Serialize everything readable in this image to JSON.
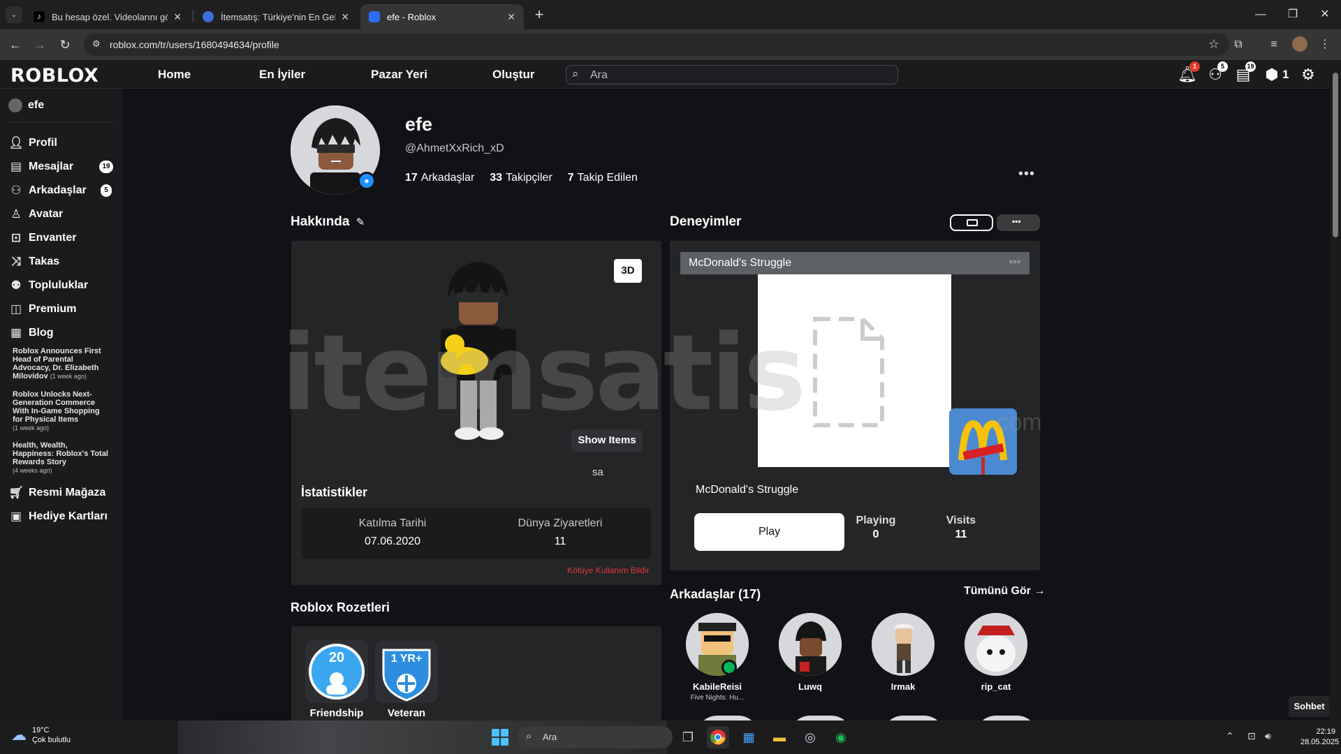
{
  "browser": {
    "tabs": [
      {
        "title": "Bu hesap özel. Videolarını görm",
        "active": false
      },
      {
        "title": "İtemsatış: Türkiye'nin En Gelişm",
        "active": false
      },
      {
        "title": "efe - Roblox",
        "active": true
      }
    ],
    "url": "roblox.com/tr/users/1680494634/profile"
  },
  "header": {
    "logo": "ROBLOX",
    "nav": [
      "Home",
      "En İyiler",
      "Pazar Yeri",
      "Oluştur"
    ],
    "search_placeholder": "Ara",
    "badges": {
      "notifications": "1",
      "friends": "5",
      "messages": "19"
    },
    "robux": "1"
  },
  "sidebar": {
    "username": "efe",
    "items": [
      {
        "label": "Profil",
        "icon": "person-icon"
      },
      {
        "label": "Mesajlar",
        "icon": "message-icon",
        "badge": "19"
      },
      {
        "label": "Arkadaşlar",
        "icon": "friends-icon",
        "badge": "5"
      },
      {
        "label": "Avatar",
        "icon": "avatar-icon"
      },
      {
        "label": "Envanter",
        "icon": "inventory-icon"
      },
      {
        "label": "Takas",
        "icon": "trade-icon"
      },
      {
        "label": "Topluluklar",
        "icon": "groups-icon"
      },
      {
        "label": "Premium",
        "icon": "premium-icon"
      },
      {
        "label": "Blog",
        "icon": "blog-icon"
      }
    ],
    "blog_posts": [
      {
        "title": "Roblox Announces First Head of Parental Advocacy, Dr. Elizabeth Milovidov",
        "when": "(1 week ago)"
      },
      {
        "title": "Roblox Unlocks Next-Generation Commerce With In-Game Shopping for Physical Items",
        "when": "(1 week ago)"
      },
      {
        "title": "Health, Wealth, Happiness: Roblox's Total Rewards Story",
        "when": "(4 weeks ago)"
      }
    ],
    "bottom_items": [
      {
        "label": "Resmi Mağaza",
        "icon": "cart-icon"
      },
      {
        "label": "Hediye Kartları",
        "icon": "giftcard-icon"
      }
    ]
  },
  "profile": {
    "name": "efe",
    "handle": "@AhmetXxRich_xD",
    "friends_count": "17",
    "friends_label": "Arkadaşlar",
    "followers_count": "33",
    "followers_label": "Takipçiler",
    "following_count": "7",
    "following_label": "Takip Edilen"
  },
  "about": {
    "title": "Hakkında",
    "btn_3d": "3D",
    "show_items": "Show Items",
    "caption": "sa",
    "stats_title": "İstatistikler",
    "join_label": "Katılma Tarihi",
    "join_value": "07.06.2020",
    "visits_label": "Dünya Ziyaretleri",
    "visits_value": "11",
    "report": "Kötüye Kullanım Bildir"
  },
  "experiences": {
    "title": "Deneyimler",
    "game_header": "McDonald's Struggle",
    "game_name": "McDonald's Struggle",
    "play": "Play",
    "playing_label": "Playing",
    "playing_value": "0",
    "visits_label": "Visits",
    "visits_value": "11"
  },
  "friends_section": {
    "title": "Arkadaşlar (17)",
    "see_all": "Tümünü Gör",
    "friends": [
      {
        "name": "KabileReisi",
        "game": "Five Nights: Hu..."
      },
      {
        "name": "Luwq",
        "game": ""
      },
      {
        "name": "Irmak",
        "game": ""
      },
      {
        "name": "rip_cat",
        "game": ""
      }
    ]
  },
  "badges_section": {
    "title": "Roblox Rozetleri",
    "badges": [
      {
        "name": "Friendship",
        "icon_text": "20"
      },
      {
        "name": "Veteran",
        "icon_text": "1 YR+"
      }
    ]
  },
  "chat": "Sohbet",
  "watermark": "itemsatis",
  "watermark_com": ".com",
  "taskbar": {
    "temp": "19°C",
    "weather": "Çok bulutlu",
    "search": "Ara",
    "time": "22:19",
    "date": "28.05.2025"
  },
  "colors": {
    "accent_blue": "#1e90ff",
    "report_red": "#e23a3a",
    "badge_red": "#e13b2a"
  }
}
